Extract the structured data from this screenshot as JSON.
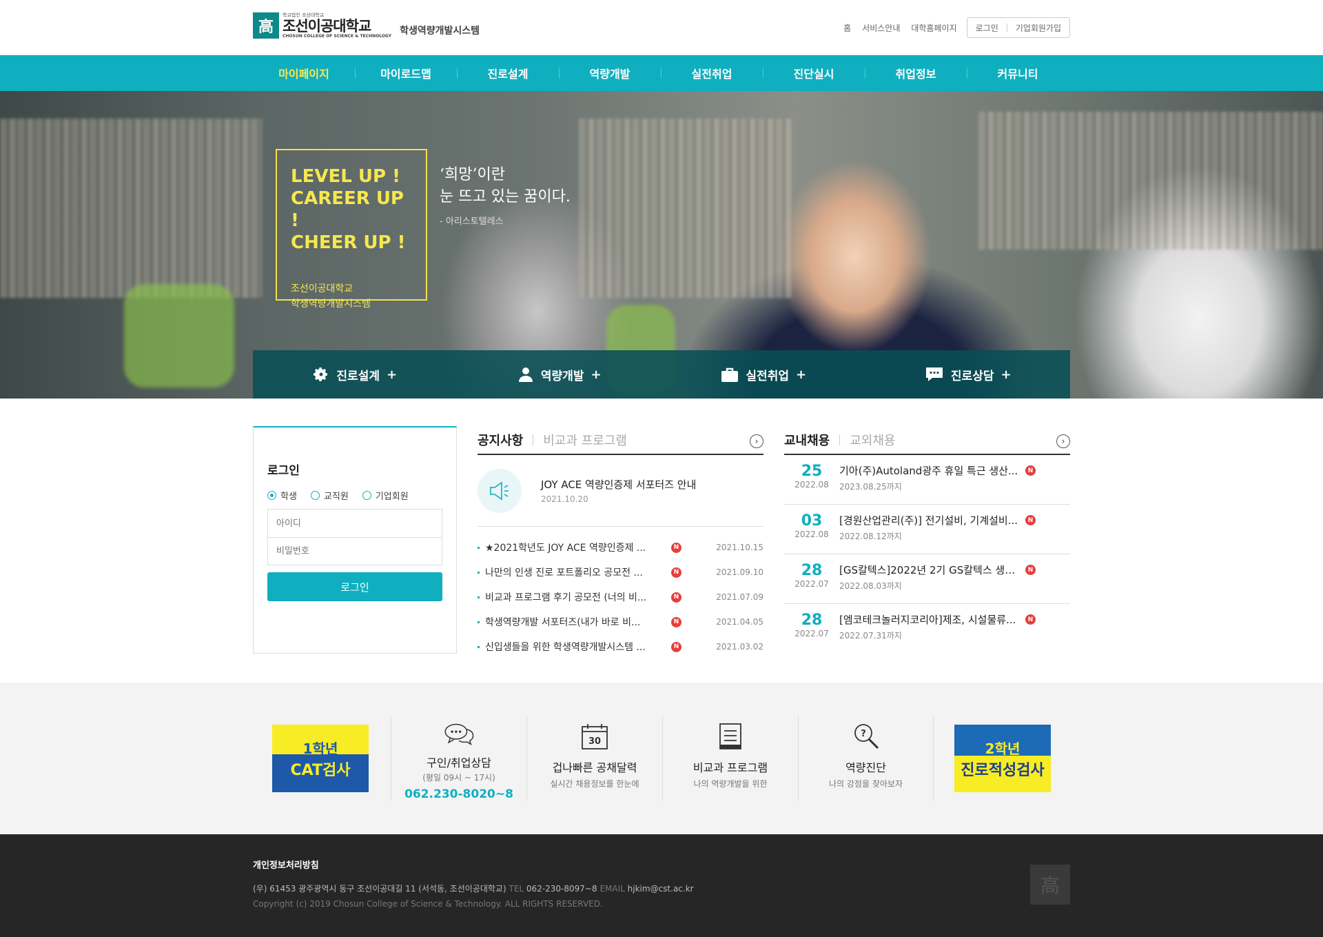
{
  "header": {
    "logo_small": "학교법인 조선대학교",
    "logo_name": "조선이공대학교",
    "logo_eng": "CHOSUN COLLEGE OF SCIENCE & TECHNOLOGY",
    "system_name": "학생역량개발시스템",
    "util": [
      "홈",
      "서비스안내",
      "대학홈페이지"
    ],
    "login": "로그인",
    "join": "기업회원가입"
  },
  "gnb": [
    "마이페이지",
    "마이로드맵",
    "진로설계",
    "역량개발",
    "실전취업",
    "진단실시",
    "취업정보",
    "커뮤니티"
  ],
  "hero": {
    "promo": [
      "LEVEL UP",
      "CAREER UP",
      "CHEER UP"
    ],
    "promo_mark": "!",
    "promo_sub1": "조선이공대학교",
    "promo_sub2": "학생역량개발시스템",
    "quote1": "‘희망’이란",
    "quote2": "눈 뜨고 있는 꿈이다.",
    "quote_author": "- 아리스토텔레스",
    "quick": [
      "진로설계",
      "역량개발",
      "실전취업",
      "진로상담"
    ],
    "quick_plus": "+"
  },
  "login": {
    "title": "로그인",
    "roles": [
      "학생",
      "교직원",
      "기업회원"
    ],
    "selected_role": "학생",
    "id_placeholder": "아이디",
    "pw_placeholder": "비밀번호",
    "button": "로그인"
  },
  "notice": {
    "tab_on": "공지사항",
    "tab_off": "비교과 프로그램",
    "more": "›",
    "featured_title": "JOY ACE 역량인증제 서포터즈 안내",
    "featured_date": "2021.10.20",
    "badge": "N",
    "items": [
      {
        "title": "★2021학년도 JOY ACE 역량인증제 ...",
        "date": "2021.10.15"
      },
      {
        "title": "나만의 인생 진로 포트폴리오 공모전 ...",
        "date": "2021.09.10"
      },
      {
        "title": "비교과 프로그램 후기 공모전 (너의 비...",
        "date": "2021.07.09"
      },
      {
        "title": "학생역량개발 서포터즈(내가 바로 비...",
        "date": "2021.04.05"
      },
      {
        "title": "신입생들을 위한 학생역량개발시스템 ...",
        "date": "2021.03.02"
      }
    ]
  },
  "jobs": {
    "tab_on": "교내채용",
    "tab_off": "교외채용",
    "more": "›",
    "badge": "N",
    "items": [
      {
        "day": "25",
        "month": "2022.08",
        "title": "기아(주)Autoland광주 휴일 특근 생산...",
        "due": "2023.08.25까지"
      },
      {
        "day": "03",
        "month": "2022.08",
        "title": "[경원산업관리(주)] 전기설비, 기계설비...",
        "due": "2022.08.12까지"
      },
      {
        "day": "28",
        "month": "2022.07",
        "title": "[GS칼텍스]2022년 2기 GS칼텍스 생산...",
        "due": "2022.08.03까지"
      },
      {
        "day": "28",
        "month": "2022.07",
        "title": "[엠코테크놀러지코리아]제조, 시설물류...",
        "due": "2022.07.31까지"
      }
    ]
  },
  "services": {
    "banner1_top": "1학년",
    "banner1_bot": "CAT검사",
    "banner2_top": "2학년",
    "banner2_bot": "진로적성검사",
    "calendar_num": "30",
    "items": [
      {
        "title": "구인/취업상담",
        "desc": "(평일 09시 ~ 17시)",
        "tel": "062.230-8020~8"
      },
      {
        "title": "겁나빠른 공채달력",
        "desc": "실시간 채용정보를 한눈에"
      },
      {
        "title": "비교과 프로그램",
        "desc": "나의 역량개발을 위한"
      },
      {
        "title": "역량진단",
        "desc": "나의 강점을 찾아보자"
      }
    ]
  },
  "footer": {
    "policy": "개인정보처리방침",
    "address": "(우) 61453 광주광역시 동구 조선이공대길 11 (서석동, 조선이공대학교)",
    "tel_label": "TEL",
    "tel": "062-230-8097~8",
    "email_label": "EMAIL",
    "email": "hjkim@cst.ac.kr",
    "copyright": "Copyright (c) 2019 Chosun College of Science & Technology. ALL RIGHTS RESERVED."
  },
  "colors": {
    "accent": "#0fafc0",
    "promo": "#f6e84e",
    "badge": "#e53e3e",
    "footer": "#262626"
  }
}
